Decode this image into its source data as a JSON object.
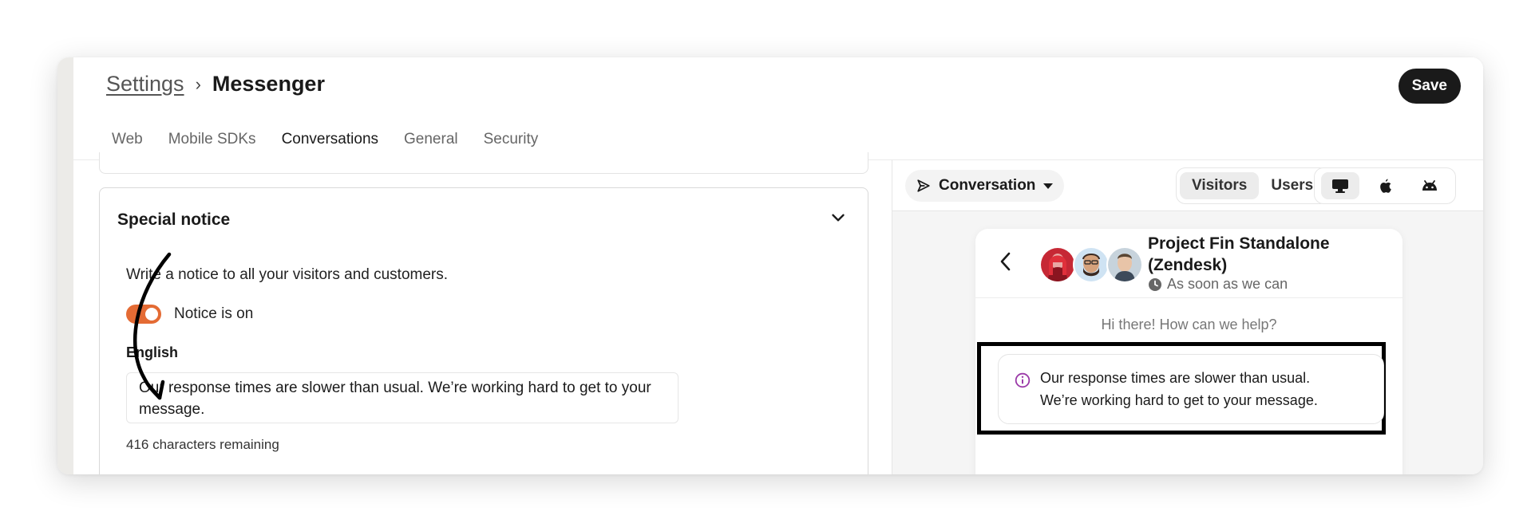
{
  "header": {
    "breadcrumb_parent": "Settings",
    "breadcrumb_separator": "›",
    "breadcrumb_current": "Messenger",
    "save_label": "Save",
    "tabs": [
      {
        "label": "Web",
        "active": false
      },
      {
        "label": "Mobile SDKs",
        "active": false
      },
      {
        "label": "Conversations",
        "active": true
      },
      {
        "label": "General",
        "active": false
      },
      {
        "label": "Security",
        "active": false
      }
    ]
  },
  "special_notice": {
    "title": "Special notice",
    "description": "Write a notice to all your visitors and customers.",
    "toggle_label": "Notice is on",
    "toggle_on": true,
    "language_label": "English",
    "notice_text": "Our response times are slower than usual. We’re working hard to get to your message.",
    "chars_remaining": "416 characters remaining"
  },
  "preview": {
    "dropdown_label": "Conversation",
    "audience": [
      {
        "label": "Visitors",
        "active": true
      },
      {
        "label": "Users",
        "active": false
      }
    ],
    "devices": [
      {
        "icon": "desktop-icon",
        "active": true
      },
      {
        "icon": "apple-icon",
        "active": false
      },
      {
        "icon": "android-icon",
        "active": false
      }
    ],
    "messenger": {
      "title_line1": "Project Fin Standalone",
      "title_line2": "(Zendesk)",
      "status": "As soon as we can",
      "greeting": "Hi there! How can we help?",
      "notice_line1": "Our response times are slower than usual.",
      "notice_line2": "We’re working hard to get to your message."
    }
  },
  "colors": {
    "accent": "#e46b34",
    "primary_button": "#1a1a1a",
    "notice_icon": "#9b3aa8"
  }
}
